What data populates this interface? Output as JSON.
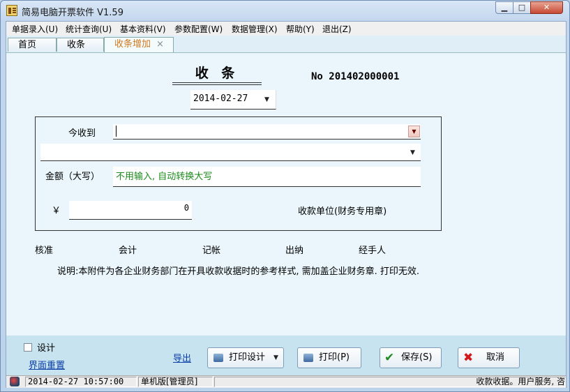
{
  "window": {
    "title": "简易电脑开票软件 V1.59"
  },
  "menu": [
    "单据录入(U)",
    "统计查询(U)",
    "基本资料(V)",
    "参数配置(W)",
    "数据管理(X)",
    "帮助(Y)",
    "退出(Z)"
  ],
  "tabs": {
    "home": "首页",
    "receipt": "收条",
    "add": "收条增加",
    "close_glyph": "×"
  },
  "form": {
    "title": "收 条",
    "number": "No  201402000001",
    "date": "2014-02-27",
    "received_from_label": "今收到",
    "received_from_value": "",
    "second_value": "",
    "amount_upper_label": "金额（大写）",
    "amount_upper_hint": "不用输入, 自动转换大写",
    "currency_symbol": "￥",
    "amount_value": "0",
    "unit_label": "收款单位(财务专用章)",
    "signatures": [
      "核准",
      "会计",
      "记帐",
      "出纳",
      "经手人"
    ],
    "note": "说明:本附件为各企业财务部门在开具收款收据时的参考样式, 需加盖企业财务章. 打印无效."
  },
  "footer": {
    "design_label": "设计",
    "design_checked": false,
    "reset_layout": "界面重置",
    "export": "导出",
    "print_design": "打印设计",
    "print": "打印(P)",
    "save": "保存(S)",
    "cancel": "取消"
  },
  "status": {
    "datetime": "2014-02-27 10:57:00",
    "mode": "单机版[管理员]",
    "message": "收款收据。用户服务, 咨"
  },
  "colors": {
    "hint_green": "#1a8a1a",
    "tab_active_orange": "#d07a1d",
    "link_blue": "#0b3ea6"
  }
}
